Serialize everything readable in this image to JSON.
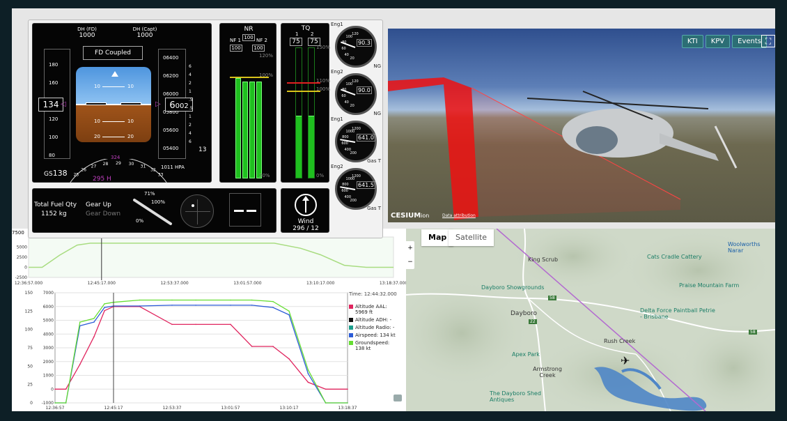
{
  "pfd": {
    "dh_fd_label": "DH (FD)",
    "dh_fd_value": "1000",
    "dh_capt_label": "DH (Capt)",
    "dh_capt_value": "1000",
    "fd_status": "FD Coupled",
    "airspeed_ticks": [
      "180",
      "160",
      "140",
      "120",
      "100",
      "80"
    ],
    "airspeed": "134",
    "alt_ticks": [
      "06400",
      "06200",
      "06000",
      "05800",
      "05600",
      "05400"
    ],
    "alt_big": "6",
    "alt_small": "002",
    "pitch_labels": [
      "10",
      "10",
      "10",
      "10",
      "20",
      "20"
    ],
    "vs_ticks": [
      "6",
      "4",
      "2",
      "1",
      ".5",
      ".5",
      "1",
      "2",
      "4",
      "6"
    ],
    "vs_value": "13",
    "gs_label": "GS",
    "gs_value": "138",
    "heading_labels": [
      "25",
      "26",
      "27",
      "28",
      "29",
      "30",
      "31",
      "32",
      "33"
    ],
    "heading": "295 H",
    "baro": "1011 HPA",
    "hdg_bug": "324"
  },
  "nr": {
    "title": "NR",
    "value": "100",
    "nf1_label": "NF 1",
    "nf1_value": "100",
    "nf2_label": "NF 2",
    "nf2_value": "100",
    "mark_high": "120%",
    "mark_mid": "100%",
    "mark_low": "20%",
    "bar_levels": [
      0.8,
      0.77,
      0.77,
      0.77
    ]
  },
  "tq": {
    "title": "TQ",
    "eng1_label": "1",
    "eng2_label": "2",
    "eng1_value": "75",
    "eng2_value": "75",
    "mark_high": "150%",
    "mark_red": "110%",
    "mark_yel": "100%",
    "mark_low": "0%",
    "bar_levels": [
      0.48,
      0.48
    ]
  },
  "dials": [
    {
      "label": "Eng1",
      "value": "90.3",
      "unit": "NG",
      "ticks": [
        "120",
        "100",
        "80",
        "60",
        "40",
        "20"
      ]
    },
    {
      "label": "Eng2",
      "value": "90.0",
      "unit": "NG",
      "ticks": [
        "120",
        "100",
        "80",
        "60",
        "40",
        "20"
      ]
    },
    {
      "label": "Eng1",
      "value": "641.0",
      "unit": "Gas T",
      "ticks": [
        "1200",
        "1000",
        "800",
        "600",
        "400",
        "200"
      ]
    },
    {
      "label": "Eng2",
      "value": "641.5",
      "unit": "Gas T",
      "ticks": [
        "1200",
        "1000",
        "800",
        "600",
        "400",
        "200"
      ]
    }
  ],
  "status": {
    "fuel_label": "Total Fuel Qty",
    "fuel_value": "1152 kg",
    "gear_up": "Gear Up",
    "gear_down": "Gear Down",
    "collective_pct": "71%",
    "collective_100": "100%",
    "collective_0": "0%",
    "wind_label": "Wind",
    "wind_value": "296 / 12"
  },
  "scene_buttons": [
    "KTI",
    "KPV",
    "Events"
  ],
  "cesium": {
    "logo": "CESIUM",
    "suffix": "ion",
    "attrib": "Data attribution"
  },
  "map": {
    "tabs": [
      "Map",
      "Satellite"
    ],
    "places": [
      {
        "name": "King Scrub"
      },
      {
        "name": "Dayboro"
      },
      {
        "name": "Rush Creek"
      },
      {
        "name": "Armstrong Creek"
      },
      {
        "name": "Woolworths Narar"
      }
    ],
    "pois": [
      {
        "name": "Cats Cradle Cattery"
      },
      {
        "name": "Dayboro Showgrounds"
      },
      {
        "name": "Praise Mountain Farm"
      },
      {
        "name": "Delta Force Paintball Petrie - Brisbane"
      },
      {
        "name": "Apex Park"
      },
      {
        "name": "The Dayboro Shed Antiques"
      }
    ],
    "road_badges": [
      "58",
      "22",
      "58"
    ]
  },
  "chart_top": {
    "y_ticks": [
      "7500",
      "5000",
      "2500",
      "0",
      "-2500"
    ],
    "x_ticks": [
      "12:36:57.000",
      "12:45:17.000",
      "12:53:37.000",
      "13:01:57.000",
      "13:10:17.000",
      "13:18:37.000"
    ]
  },
  "chart_main": {
    "left_ticks": [
      "150",
      "125",
      "100",
      "75",
      "50",
      "25",
      "0"
    ],
    "right_ticks": [
      "7000",
      "6000",
      "5000",
      "4000",
      "3000",
      "2000",
      "1000",
      "0",
      "-1000"
    ],
    "x_ticks": [
      "12:36:57",
      "12:45:17",
      "12:53:37",
      "13:01:57",
      "13:10:17",
      "13:18:37"
    ],
    "time_label": "Time: 12:44:32.000",
    "legend": [
      {
        "label": "Altitude AAL:",
        "value": "5969 ft",
        "color": "#e0245e"
      },
      {
        "label": "Altitude ADH: -",
        "value": "",
        "color": "#111111"
      },
      {
        "label": "Altitude Radio: -",
        "value": "",
        "color": "#1a9e8c"
      },
      {
        "label": "Airspeed: 134 kt",
        "value": "",
        "color": "#2b5bd7"
      },
      {
        "label": "Groundspeed:",
        "value": "138 kt",
        "color": "#66dd33"
      }
    ]
  },
  "chart_data": {
    "type": "line",
    "x": [
      "12:36:57",
      "12:38:30",
      "12:40:30",
      "12:42:30",
      "12:44:00",
      "12:45:17",
      "12:49:00",
      "12:53:37",
      "12:57:00",
      "13:01:57",
      "13:05:00",
      "13:08:00",
      "13:10:17",
      "13:13:00",
      "13:15:30",
      "13:18:37"
    ],
    "series": [
      {
        "name": "Altitude AAL",
        "values": [
          0,
          0,
          1800,
          3800,
          5700,
          6000,
          6000,
          4700,
          4700,
          4700,
          3100,
          3100,
          2200,
          500,
          0,
          0
        ]
      },
      {
        "name": "Airspeed",
        "values": [
          0,
          0,
          105,
          110,
          130,
          132,
          132,
          133,
          133,
          133,
          133,
          130,
          120,
          40,
          0,
          0
        ]
      },
      {
        "name": "Groundspeed",
        "values": [
          0,
          0,
          110,
          115,
          135,
          137,
          140,
          140,
          140,
          140,
          140,
          138,
          125,
          45,
          0,
          0
        ]
      }
    ],
    "y_left_range": [
      0,
      150
    ],
    "y_right_range": [
      -1000,
      7000
    ],
    "overview": {
      "name": "Altitude",
      "values": [
        0,
        0,
        3000,
        5500,
        5969,
        5969,
        5969,
        5969,
        5969,
        5969,
        5969,
        4700,
        3100,
        500,
        0,
        0
      ],
      "ylim": [
        -2500,
        7500
      ]
    }
  }
}
